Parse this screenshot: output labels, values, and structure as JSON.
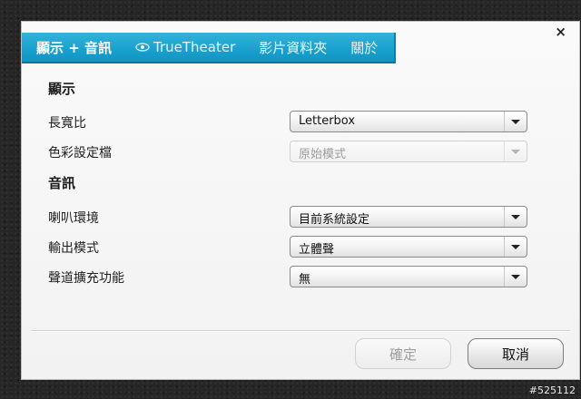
{
  "tabs": {
    "display_audio": "顯示 + 音訊",
    "truetheater": "TrueTheater",
    "video_info": "影片資料夾",
    "about": "關於"
  },
  "close_label": "×",
  "display": {
    "title": "顯示",
    "aspect_ratio": {
      "label": "長寬比",
      "value": "Letterbox"
    },
    "color_profile": {
      "label": "色彩設定檔",
      "value": "原始模式"
    }
  },
  "audio": {
    "title": "音訊",
    "speaker": {
      "label": "喇叭環境",
      "value": "目前系統設定"
    },
    "output_mode": {
      "label": "輸出模式",
      "value": "立體聲"
    },
    "channel_expansion": {
      "label": "聲道擴充功能",
      "value": "無"
    }
  },
  "buttons": {
    "ok": "確定",
    "cancel": "取消"
  },
  "watermark": "#525112",
  "colors": {
    "tab_bar": "#1aa2cf",
    "background": "#262626"
  }
}
